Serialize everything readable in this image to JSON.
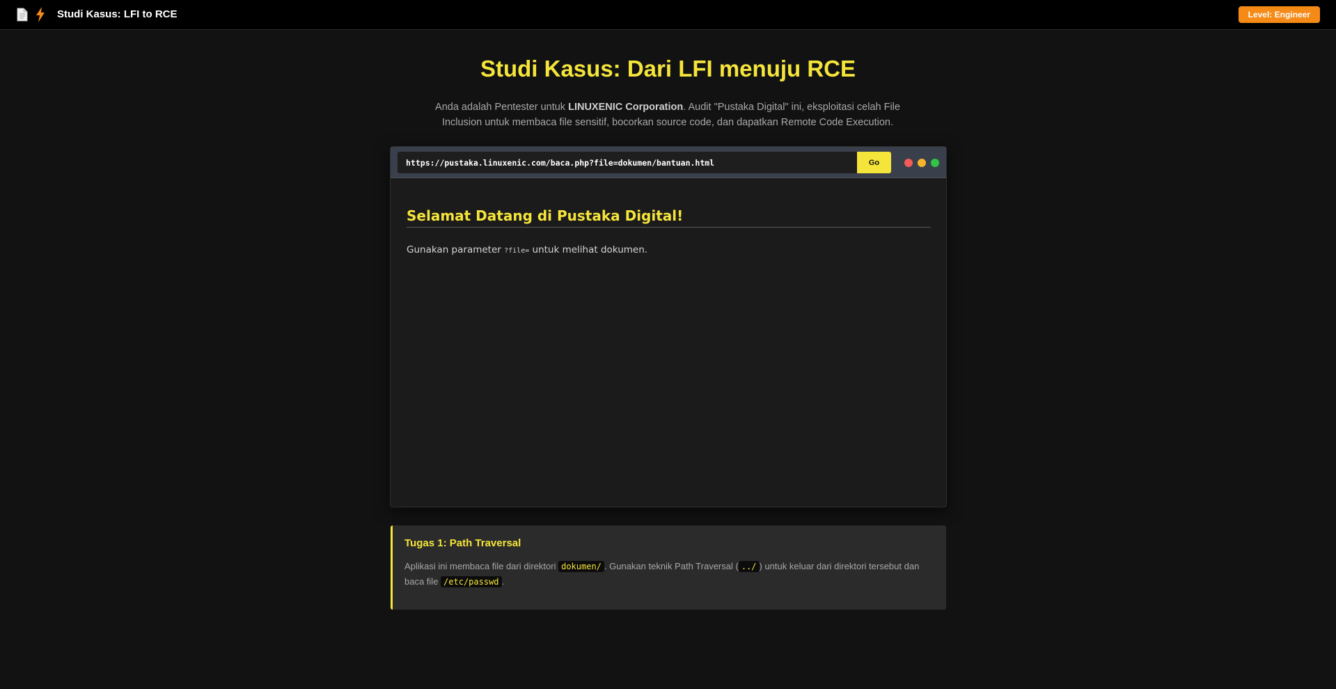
{
  "header": {
    "title": "Studi Kasus: LFI to RCE",
    "level_badge": "Level: Engineer",
    "icons": [
      "document-icon",
      "lightning-icon"
    ]
  },
  "hero": {
    "title": "Studi Kasus: Dari LFI menuju RCE",
    "desc_before": "Anda adalah Pentester untuk ",
    "desc_company": "LINUXENIC Corporation",
    "desc_after": ". Audit \"Pustaka Digital\" ini, eksploitasi celah File Inclusion untuk membaca file sensitif, bocorkan source code, dan dapatkan Remote Code Execution."
  },
  "browser": {
    "url": "https://pustaka.linuxenic.com/baca.php?file=dokumen/bantuan.html",
    "go_label": "Go",
    "window_controls": [
      "red",
      "yellow",
      "green"
    ],
    "content": {
      "heading": "Selamat Datang di Pustaka Digital!",
      "text_before": "Gunakan parameter ",
      "param": "?file=",
      "text_after": " untuk melihat dokumen."
    }
  },
  "task": {
    "title": "Tugas 1: Path Traversal",
    "text_1": "Aplikasi ini membaca file dari direktori ",
    "code_1": "dokumen/",
    "text_2": ". Gunakan teknik Path Traversal (",
    "code_2": "../",
    "text_3": ") untuk keluar dari direktori tersebut dan baca file ",
    "code_3": "/etc/passwd",
    "text_4": "."
  },
  "colors": {
    "accent": "#f5e53a",
    "badge": "#f58a16",
    "background": "#121212",
    "topbar": "#000000",
    "browser_bar": "#39404c"
  }
}
